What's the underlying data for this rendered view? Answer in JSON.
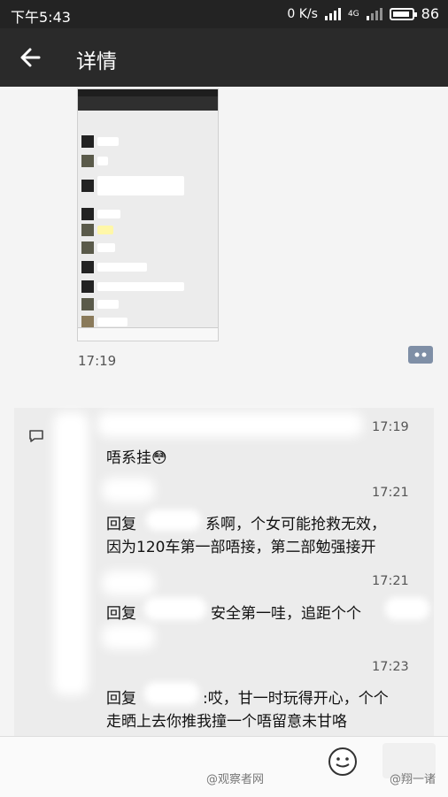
{
  "status_bar": {
    "time": "下午5:43",
    "network_speed": "0 K/s",
    "signal_tag": "4G",
    "battery": "86"
  },
  "header": {
    "title": "详情"
  },
  "post": {
    "time": "17:19"
  },
  "replies": [
    {
      "time": "17:19",
      "text": "唔系挂😳"
    },
    {
      "time": "17:21",
      "text_1": "回复",
      "text_2": "系啊，个女可能抢救无效，",
      "text_3": "因为120车第一部唔接，第二部勉强接开"
    },
    {
      "time": "17:21",
      "text_1": "回复",
      "text_2": "安全第一哇，追距个个"
    },
    {
      "time": "17:23",
      "text_1": "回复",
      "text_2": ":哎，甘一时玩得开心，个个",
      "text_3": "走晒上去你推我撞一个唔留意未甘咯"
    }
  ],
  "watermarks": {
    "left": "@观察者网",
    "right": "@翔一诸"
  }
}
